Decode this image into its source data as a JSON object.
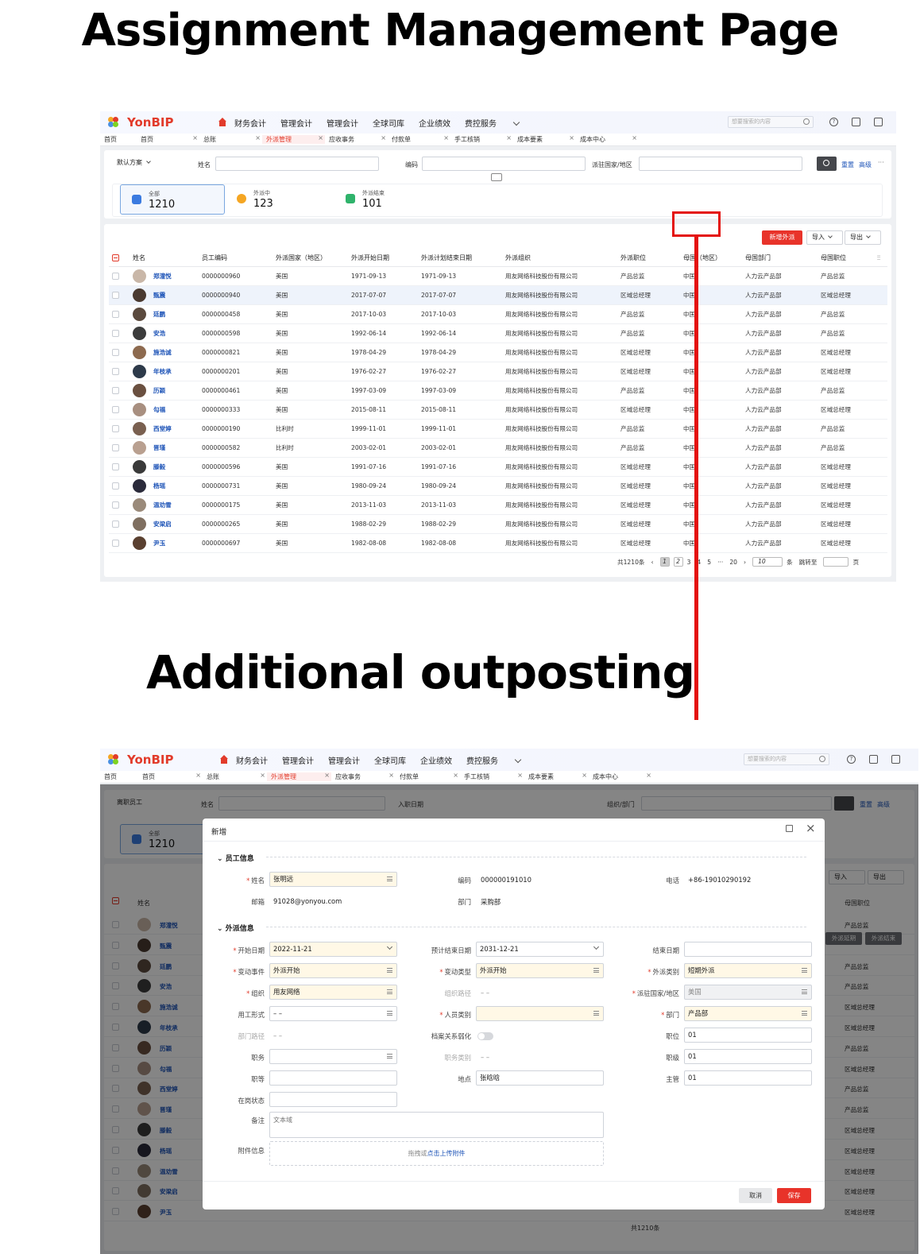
{
  "titles": {
    "top": "Assignment Management Page",
    "bottom": "Additional outposting"
  },
  "app": {
    "brand": "YonBIP",
    "menu": [
      "财务会计",
      "管理会计",
      "管理会计",
      "全球司库",
      "企业绩效",
      "费控服务"
    ],
    "search_placeholder": "想要搜索的内容",
    "tabs_home": "首页",
    "tabs": [
      "首页",
      "总账",
      "外派管理",
      "应收事务",
      "付款单",
      "手工核销",
      "成本要素",
      "成本中心"
    ]
  },
  "list_page": {
    "scheme": "默认方案",
    "filters": {
      "name": "姓名",
      "code": "编码",
      "country": "派驻国家/地区"
    },
    "reset": "重置",
    "advanced": "高级",
    "more": "···",
    "stats": [
      {
        "label": "全部",
        "value": "1210"
      },
      {
        "label": "外派中",
        "value": "123"
      },
      {
        "label": "外派结束",
        "value": "101"
      }
    ],
    "add_button": "新增外派",
    "import": "导入",
    "export": "导出",
    "columns": [
      "姓名",
      "员工编码",
      "外派国家（地区）",
      "外派开始日期",
      "外派计划结束日期",
      "外派组织",
      "外派职位",
      "母国（地区）",
      "母国部门",
      "母国职位"
    ],
    "rows": [
      [
        "郑潼悦",
        "0000000960",
        "美国",
        "1971-09-13",
        "1971-09-13",
        "用友网络科技股份有限公司",
        "产品总监",
        "中国",
        "人力云产品部",
        "产品总监"
      ],
      [
        "甄震",
        "0000000940",
        "美国",
        "2017-07-07",
        "2017-07-07",
        "用友网络科技股份有限公司",
        "区域总经理",
        "中国",
        "人力云产品部",
        "区域总经理"
      ],
      [
        "廷鹏",
        "0000000458",
        "美国",
        "2017-10-03",
        "2017-10-03",
        "用友网络科技股份有限公司",
        "产品总监",
        "中国",
        "人力云产品部",
        "产品总监"
      ],
      [
        "安浩",
        "0000000598",
        "美国",
        "1992-06-14",
        "1992-06-14",
        "用友网络科技股份有限公司",
        "产品总监",
        "中国",
        "人力云产品部",
        "产品总监"
      ],
      [
        "施浩诚",
        "0000000821",
        "美国",
        "1978-04-29",
        "1978-04-29",
        "用友网络科技股份有限公司",
        "区域总经理",
        "中国",
        "人力云产品部",
        "区域总经理"
      ],
      [
        "年枝承",
        "0000000201",
        "美国",
        "1976-02-27",
        "1976-02-27",
        "用友网络科技股份有限公司",
        "区域总经理",
        "中国",
        "人力云产品部",
        "区域总经理"
      ],
      [
        "历颖",
        "0000000461",
        "美国",
        "1997-03-09",
        "1997-03-09",
        "用友网络科技股份有限公司",
        "产品总监",
        "中国",
        "人力云产品部",
        "产品总监"
      ],
      [
        "勾福",
        "0000000333",
        "美国",
        "2015-08-11",
        "2015-08-11",
        "用友网络科技股份有限公司",
        "区域总经理",
        "中国",
        "人力云产品部",
        "区域总经理"
      ],
      [
        "西堂婷",
        "0000000190",
        "比利时",
        "1999-11-01",
        "1999-11-01",
        "用友网络科技股份有限公司",
        "产品总监",
        "中国",
        "人力云产品部",
        "产品总监"
      ],
      [
        "晋瑾",
        "0000000582",
        "比利时",
        "2003-02-01",
        "2003-02-01",
        "用友网络科技股份有限公司",
        "产品总监",
        "中国",
        "人力云产品部",
        "产品总监"
      ],
      [
        "滕毅",
        "0000000596",
        "美国",
        "1991-07-16",
        "1991-07-16",
        "用友网络科技股份有限公司",
        "区域总经理",
        "中国",
        "人力云产品部",
        "区域总经理"
      ],
      [
        "杨瑶",
        "0000000731",
        "美国",
        "1980-09-24",
        "1980-09-24",
        "用友网络科技股份有限公司",
        "区域总经理",
        "中国",
        "人力云产品部",
        "区域总经理"
      ],
      [
        "温劝雪",
        "0000000175",
        "美国",
        "2013-11-03",
        "2013-11-03",
        "用友网络科技股份有限公司",
        "区域总经理",
        "中国",
        "人力云产品部",
        "区域总经理"
      ],
      [
        "安梁启",
        "0000000265",
        "美国",
        "1988-02-29",
        "1988-02-29",
        "用友网络科技股份有限公司",
        "区域总经理",
        "中国",
        "人力云产品部",
        "区域总经理"
      ],
      [
        "尹玉",
        "0000000697",
        "美国",
        "1982-08-08",
        "1982-08-08",
        "用友网络科技股份有限公司",
        "区域总经理",
        "中国",
        "人力云产品部",
        "区域总经理"
      ]
    ],
    "pager": {
      "total": "共1210条",
      "pages": [
        "1",
        "2",
        "3",
        "4",
        "5",
        "···",
        "20"
      ],
      "size": "10",
      "unit": "条",
      "goto": "跳转至",
      "page_unit": "页"
    }
  },
  "bg_page": {
    "scheme": "离职员工",
    "filters": {
      "name": "姓名",
      "date": "入职日期",
      "org": "组织/部门"
    },
    "stat_label": "全部",
    "stat_value": "1210",
    "col_name": "姓名",
    "col_pos": "母国职位",
    "names": [
      "郑潼悦",
      "甄震",
      "廷鹏",
      "安浩",
      "施浩诚",
      "年枝承",
      "历颖",
      "勾福",
      "西堂婷",
      "晋瑾",
      "滕毅",
      "杨瑶",
      "温劝雪",
      "安梁启",
      "尹玉"
    ],
    "positions": [
      "产品总监",
      "",
      "产品总监",
      "产品总监",
      "区域总经理",
      "区域总经理",
      "产品总监",
      "区域总经理",
      "产品总监",
      "产品总监",
      "区域总经理",
      "区域总经理",
      "区域总经理",
      "区域总经理",
      "区域总经理"
    ],
    "row_action_1": "外派延期",
    "row_action_2": "外派结束",
    "pager_total": "共1210条"
  },
  "modal": {
    "title": "新增",
    "section_employee": "员工信息",
    "section_assign": "外派信息",
    "employee": {
      "name_label": "姓名",
      "name_value": "张明远",
      "code_label": "编码",
      "code_value": "000000191010",
      "phone_label": "电话",
      "phone_value": "+86-19010290192",
      "email_label": "邮箱",
      "email_value": "91028@yonyou.com",
      "dept_label": "部门",
      "dept_value": "采购部"
    },
    "assign": {
      "start_label": "开始日期",
      "start_value": "2022-11-21",
      "plan_end_label": "预计结束日期",
      "plan_end_value": "2031-12-21",
      "end_label": "结束日期",
      "end_value": "",
      "event_label": "变动事件",
      "event_value": "外派开始",
      "type_label": "变动类型",
      "type_value": "外派开始",
      "cat_label": "外派类别",
      "cat_value": "短期外派",
      "org_label": "组织",
      "org_value": "用友网络",
      "orgpath_label": "组织路径",
      "orgpath_value": "– –",
      "country_label": "派驻国家/地区",
      "country_value": "美国",
      "employ_label": "用工形式",
      "employ_value": "– –",
      "ptype_label": "人员类别",
      "ptype_value": "",
      "dept_label": "部门",
      "dept_value": "产品部",
      "deptpath_label": "部门路径",
      "deptpath_value": "– –",
      "archive_label": "档案关系弱化",
      "post_label": "职位",
      "post_value": "01",
      "duty_label": "职务",
      "duty_value": "",
      "dutycat_label": "职务类别",
      "dutycat_value": "– –",
      "level_label": "职级",
      "level_value": "01",
      "grade_label": "职等",
      "grade_value": "",
      "place_label": "地点",
      "place_value": "张晗晗",
      "mgr_label": "主管",
      "mgr_value": "01",
      "status_label": "在岗状态",
      "status_value": "",
      "remark_label": "备注",
      "remark_placeholder": "文本域",
      "attach_label": "附件信息",
      "attach_hint": "拖拽或",
      "attach_link": "点击上传附件"
    },
    "cancel": "取消",
    "save": "保存"
  }
}
